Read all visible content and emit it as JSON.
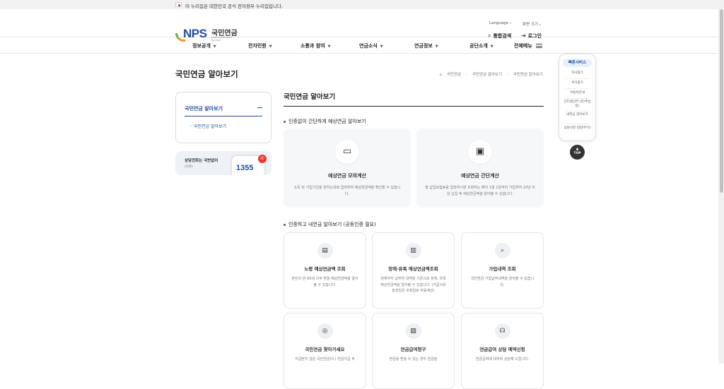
{
  "gov_banner": {
    "text": "이 누리집은 대한민국 공식 전자정부 누리집입니다."
  },
  "header": {
    "logo_text": "NPS",
    "logo_kr": "국민연금",
    "logo_en": "National Pension Service",
    "language_label": "Language",
    "zoom_label": "화면 크기",
    "search_label": "통합검색",
    "login_label": "로그인"
  },
  "gnb": [
    {
      "label": "정보공개"
    },
    {
      "label": "전자민원"
    },
    {
      "label": "소통과 참여"
    },
    {
      "label": "연금소식"
    },
    {
      "label": "연금정보"
    },
    {
      "label": "공단소개"
    }
  ],
  "gnb_all_label": "전체메뉴",
  "page_title": "국민연금 알아보기",
  "breadcrumb": {
    "home": "국민연금",
    "level1": "국민연금 알아보기",
    "level2": "국민연금 알아보기"
  },
  "sidebar": {
    "heading": "국민연금 알아보기",
    "sub_item": "국민연금 알아보기"
  },
  "call": {
    "title": "상담전화는 국번없이",
    "sub": "(유료)",
    "number": "1355"
  },
  "content": {
    "title": "국민연금 알아보기",
    "section1": "인증없이 간단하게 예상연금 알아보기",
    "section2": "인증하고 내연금 알아보기 (공동인증 필요)"
  },
  "big_cards": [
    {
      "title": "예상연금 모의계산",
      "desc": "소득 및 가입기간을 원하는대로 입력하여 예상연금액을 확인할 수 있습니다."
    },
    {
      "title": "예상연금 간단계산",
      "desc": "월 납입보험료를 입력하시면 조회하는 해의 1월 1일부터 가입하여 10년 이상 납입 후 예상연금액을 알아볼 수 있습니다."
    }
  ],
  "small_cards": [
    {
      "title": "노령 예상연금액 조회",
      "desc": "본인이 만 60세 이후 받을 예상연금액을 알아볼 수 있습니다."
    },
    {
      "title": "장애·유족 예상연금액조회",
      "desc": "현재까지 납부한 내역을 기준으로 장애, 유족 예상연금액을 알아볼 수 있습니다. (지급사유발생일은 조회일로 자동계산)"
    },
    {
      "title": "가입내역 조회",
      "desc": "국민연금 가입납부내역을 알아볼 수 있습니다."
    },
    {
      "title": "국민연금 찾아가세요",
      "desc": "지급받지 않은 국민연금이나 연금지급 후"
    },
    {
      "title": "연금급여청구",
      "desc": "연금을 받을 수 있는 경우 연금을"
    },
    {
      "title": "연금급여 상담 예약신청",
      "desc": "연금급여에 대하여 상담해 드립니다."
    }
  ],
  "quick": {
    "heading": "빠른서비스",
    "items": [
      "지사찾기",
      "서식찾기",
      "이용자안내",
      "인터넷납부 (전/추납 등)",
      "내연금 알아보기",
      "상담신청 (일반주기)"
    ]
  },
  "top_label": "TOP"
}
